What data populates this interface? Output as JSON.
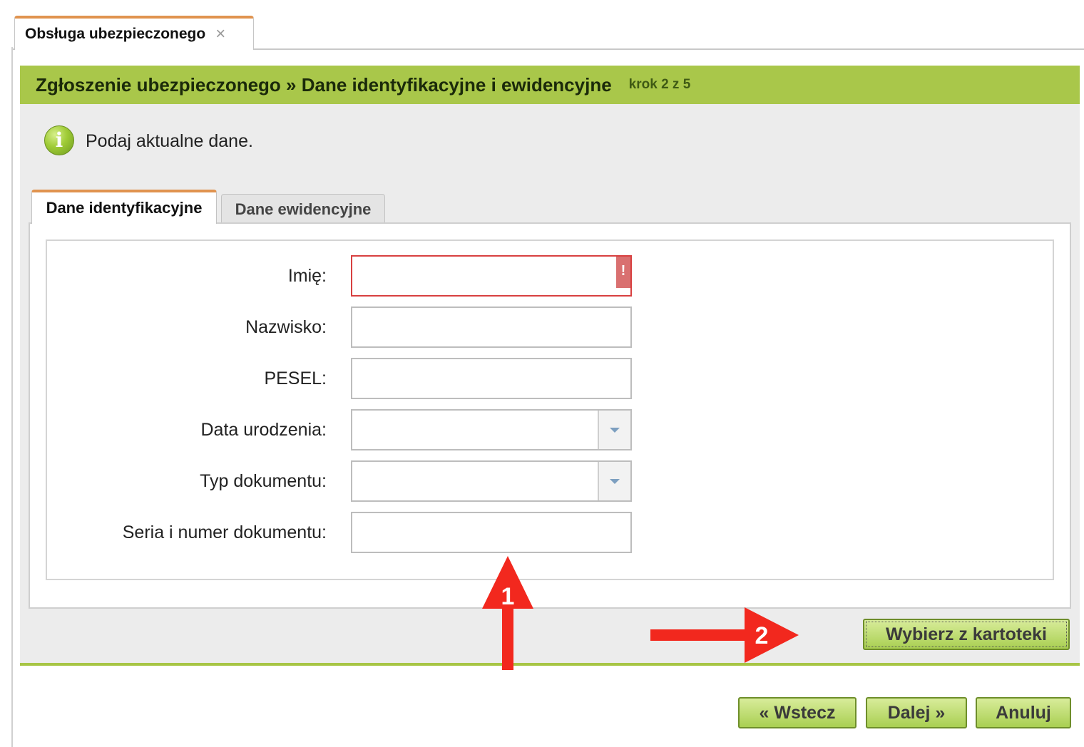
{
  "outer_tab": {
    "label": "Obsługa ubezpieczonego",
    "close_symbol": "×"
  },
  "panel": {
    "title": "Zgłoszenie ubezpieczonego » Dane identyfikacyjne i ewidencyjne",
    "step": "krok 2 z 5",
    "info_icon": "info-icon",
    "info_text": "Podaj aktualne dane.",
    "accent_color": "#a9c74a"
  },
  "tabs": [
    {
      "label": "Dane identyfikacyjne",
      "active": true
    },
    {
      "label": "Dane ewidencyjne",
      "active": false
    }
  ],
  "form": {
    "fields": [
      {
        "label": "Imię:",
        "value": "",
        "error_flag": "!"
      },
      {
        "label": "Nazwisko:",
        "value": ""
      },
      {
        "label": "PESEL:",
        "value": ""
      },
      {
        "label": "Data urodzenia:",
        "value": ""
      },
      {
        "label": "Typ dokumentu:",
        "value": ""
      },
      {
        "label": "Seria i numer dokumentu:",
        "value": ""
      }
    ]
  },
  "buttons": {
    "kartoteka": "Wybierz z kartoteki",
    "back": "« Wstecz",
    "next": "Dalej »",
    "cancel": "Anuluj"
  },
  "annotations": [
    {
      "number": "1",
      "color": "#f2281e"
    },
    {
      "number": "2",
      "color": "#f2281e"
    }
  ]
}
